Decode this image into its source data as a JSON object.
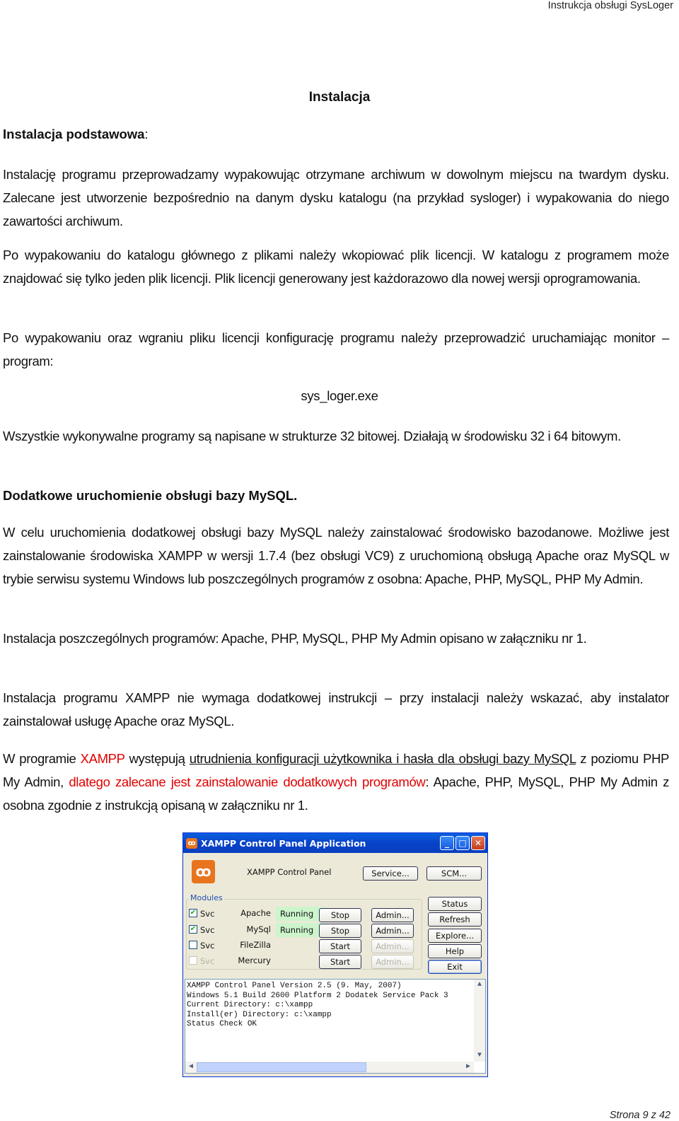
{
  "header": {
    "doc_title": "Instrukcja obsługi SysLoger"
  },
  "title": "Instalacja",
  "section1": {
    "heading": "Instalacja podstawowa",
    "heading_suffix": ":",
    "p1": "Instalację programu przeprowadzamy wypakowując otrzymane archiwum w dowolnym miejscu na twardym dysku. Zalecane jest utworzenie bezpośrednio na danym dysku katalogu (na przykład sysloger) i wypakowania do niego zawartości archiwum.",
    "p2": "Po wypakowaniu do katalogu głównego z plikami należy wkopiować plik licencji. W katalogu z programem może znajdować się tylko jeden plik licencji. Plik licencji generowany jest każdorazowo dla nowej wersji oprogramowania.",
    "p3": "Po wypakowaniu oraz wgraniu pliku licencji konfigurację programu należy przeprowadzić uruchamiając monitor – program:",
    "exe": "sys_loger.exe",
    "p4": "Wszystkie wykonywalne programy są napisane w strukturze 32 bitowej. Działają w środowisku 32 i 64 bitowym."
  },
  "section2": {
    "heading": "Dodatkowe uruchomienie obsługi bazy MySQL.",
    "p1": "W celu uruchomienia dodatkowej obsługi bazy MySQL należy zainstalować środowisko bazodanowe. Możliwe jest zainstalowanie środowiska XAMPP w wersji 1.7.4 (bez obsługi VC9) z uruchomioną obsługą Apache oraz MySQL w trybie serwisu systemu Windows lub poszczególnych programów z osobna: Apache, PHP, MySQL, PHP My Admin.",
    "p2": "Instalacja poszczególnych programów: Apache, PHP, MySQL, PHP My Admin opisano w załączniku nr 1.",
    "p3": "Instalacja programu XAMPP nie wymaga dodatkowej instrukcji – przy instalacji należy wskazać, aby instalator zainstalował usługę Apache oraz MySQL.",
    "p4": {
      "t1": "W programie ",
      "t2_red": "XAMPP",
      "t3": " występują ",
      "t4_underline": "utrudnienia konfiguracji użytkownika i hasła dla obsługi bazy MySQL",
      "t5": " z poziomu PHP My Admin, ",
      "t6_red": "dlatego zalecane jest zainstalowanie dodatkowych programów",
      "t7": ": Apache, PHP, MySQL, PHP My Admin z osobna zgodnie z instrukcją opisaną w załączniku nr 1."
    }
  },
  "xampp": {
    "window_title": "XAMPP Control Panel Application",
    "panel_title": "XAMPP Control Panel",
    "service_button": "Service...",
    "scm_button": "SCM...",
    "modules_label": "Modules",
    "modules": [
      {
        "svc": "Svc",
        "checked": true,
        "name": "Apache",
        "status": "Running",
        "action": "Stop",
        "admin": "Admin...",
        "admin_enabled": true,
        "svc_enabled": true
      },
      {
        "svc": "Svc",
        "checked": true,
        "name": "MySql",
        "status": "Running",
        "action": "Stop",
        "admin": "Admin...",
        "admin_enabled": true,
        "svc_enabled": true
      },
      {
        "svc": "Svc",
        "checked": false,
        "name": "FileZilla",
        "status": "",
        "action": "Start",
        "admin": "Admin...",
        "admin_enabled": false,
        "svc_enabled": true
      },
      {
        "svc": "Svc",
        "checked": false,
        "name": "Mercury",
        "status": "",
        "action": "Start",
        "admin": "Admin...",
        "admin_enabled": false,
        "svc_enabled": false
      }
    ],
    "side_buttons": [
      "Status",
      "Refresh",
      "Explore...",
      "Help",
      "Exit"
    ],
    "log_lines": [
      "XAMPP Control Panel Version 2.5 (9. May, 2007)",
      "Windows 5.1 Build 2600 Platform 2 Dodatek Service Pack 3",
      "Current Directory: c:\\xampp",
      "Install(er) Directory: c:\\xampp",
      "Status Check OK"
    ]
  },
  "footer": {
    "page_label": "Strona 9 z 42"
  },
  "colors": {
    "highlight_red": "#e00000",
    "xp_title_blue": "#0842c8",
    "running_bg": "#ccf5cc",
    "xampp_orange": "#e8741e"
  }
}
